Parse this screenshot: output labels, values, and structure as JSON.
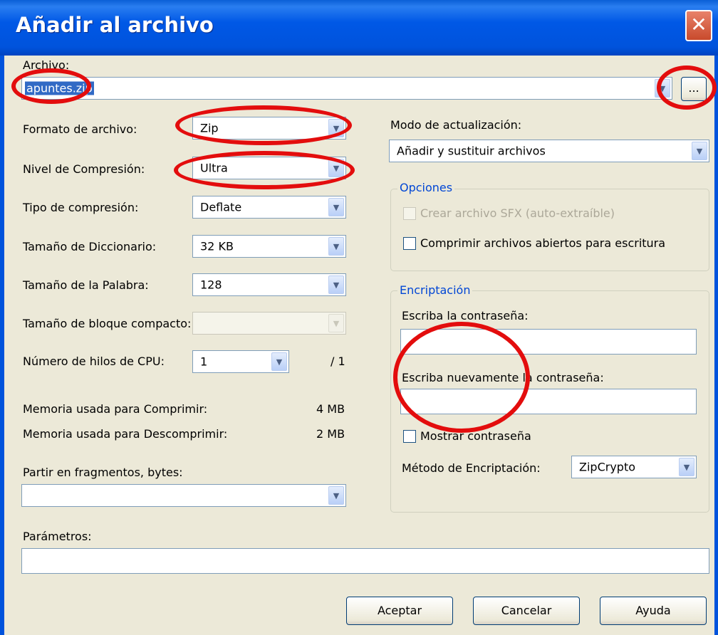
{
  "window": {
    "title": "Añadir al archivo",
    "close_glyph": "✕"
  },
  "archive": {
    "label": "Archivo:",
    "value": "apuntes.zip",
    "browse_label": "..."
  },
  "left": {
    "format_label": "Formato de archivo:",
    "format_value": "Zip",
    "level_label": "Nivel de Compresión:",
    "level_value": "Ultra",
    "method_label": "Tipo de compresión:",
    "method_value": "Deflate",
    "dict_label": "Tamaño de Diccionario:",
    "dict_value": "32 KB",
    "word_label": "Tamaño de la Palabra:",
    "word_value": "128",
    "solid_label": "Tamaño de bloque compacto:",
    "solid_value": "",
    "threads_label": "Número de hilos de CPU:",
    "threads_value": "1",
    "threads_max": "/ 1",
    "mem_comp_label": "Memoria usada para Comprimir:",
    "mem_comp_value": "4 MB",
    "mem_decomp_label": "Memoria usada para Descomprimir:",
    "mem_decomp_value": "2 MB",
    "split_label": "Partir en fragmentos, bytes:",
    "split_value": ""
  },
  "right": {
    "update_label": "Modo de actualización:",
    "update_value": "Añadir y sustituir archivos",
    "options_legend": "Opciones",
    "sfx_label": "Crear archivo SFX (auto-extraíble)",
    "shared_label": "Comprimir archivos abiertos para escritura",
    "enc_legend": "Encriptación",
    "pwd_label": "Escriba la contraseña:",
    "pwd_value": "",
    "pwd2_label": "Escriba nuevamente la contraseña:",
    "pwd2_value": "",
    "show_pwd_label": "Mostrar contraseña",
    "enc_method_label": "Método de Encriptación:",
    "enc_method_value": "ZipCrypto"
  },
  "params": {
    "label": "Parámetros:",
    "value": ""
  },
  "buttons": {
    "ok": "Aceptar",
    "cancel": "Cancelar",
    "help": "Ayuda"
  },
  "colors": {
    "annotation": "#e30d0d",
    "title_bar": "#0053dc",
    "dialog_bg": "#ece9d8"
  },
  "icons": {
    "dropdown": "chevron-down-icon",
    "close": "close-icon"
  }
}
